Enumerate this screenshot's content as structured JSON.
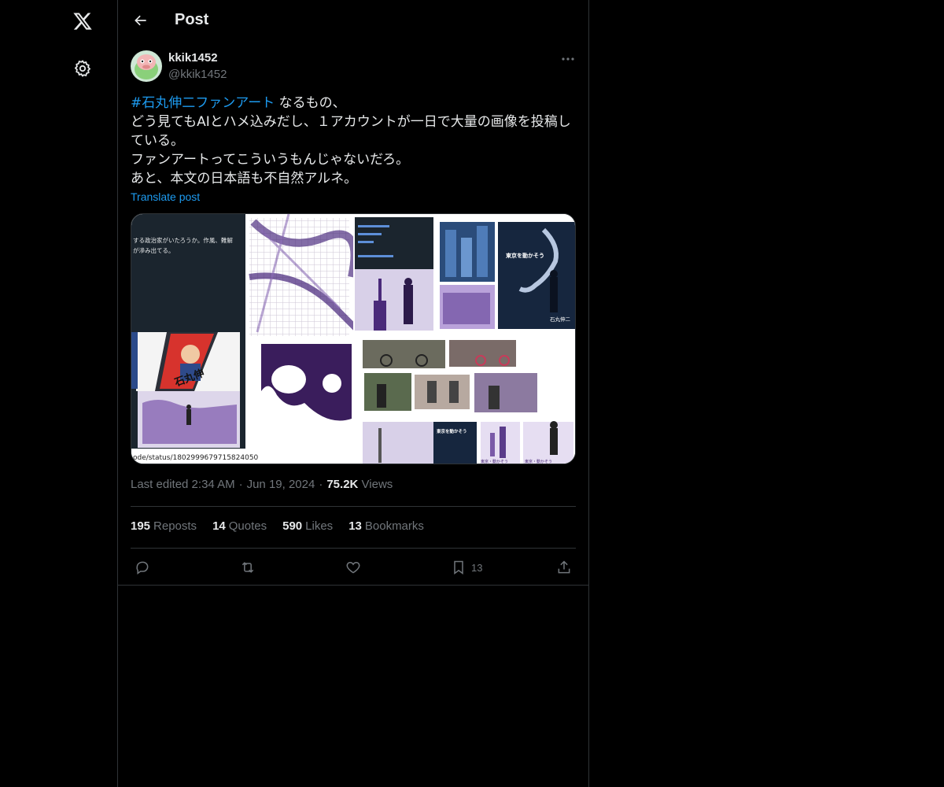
{
  "nav": {
    "logo_icon": "x-logo-icon",
    "settings_icon": "gear-icon"
  },
  "header": {
    "back_icon": "arrow-left-icon",
    "title": "Post"
  },
  "post": {
    "author": {
      "display_name": "kkik1452",
      "handle": "@kkik1452"
    },
    "more_icon": "more-horizontal-icon",
    "text": {
      "hashtag": "#石丸伸二ファンアート",
      "line1_rest": " なるもの、",
      "line2": "どう見てもAIとハメ込みだし、１アカウントが一日で大量の画像を投稿し",
      "line3": "ている。",
      "line4": "ファンアートってこういうもんじゃないだろ。",
      "line5": "あと、本文の日本語も不自然アルネ。"
    },
    "translate": "Translate post",
    "media": {
      "tile_a_caption": "ode/status/1802999679715824050",
      "tile_a_text1": "する政治家がいたろうか。作風、難解",
      "tile_a_text2": "が滲み出てる。",
      "tile_a_poster": "石丸伸",
      "tile_b_poster_title": "東京を動かそう",
      "tile_b_poster_name": "石丸伸二",
      "tile_c_banner1": "東京・動かそう",
      "tile_c_banner2": "東京・動かそう",
      "tile_c_poster": "東京を動かそう"
    },
    "meta": {
      "edited": "Last edited 2:34 AM",
      "date": "Jun 19, 2024",
      "views_count": "75.2K",
      "views_label": "Views"
    },
    "stats": {
      "reposts_count": "195",
      "reposts_label": "Reposts",
      "quotes_count": "14",
      "quotes_label": "Quotes",
      "likes_count": "590",
      "likes_label": "Likes",
      "bookmarks_count": "13",
      "bookmarks_label": "Bookmarks"
    },
    "actions": {
      "reply_icon": "reply-icon",
      "repost_icon": "repost-icon",
      "like_icon": "heart-icon",
      "bookmark_icon": "bookmark-icon",
      "bookmark_count": "13",
      "share_icon": "share-icon"
    }
  },
  "colors": {
    "background": "#000000",
    "text": "#e7e9ea",
    "muted": "#71767b",
    "accent": "#1d9bf0",
    "border": "#2f3336"
  }
}
